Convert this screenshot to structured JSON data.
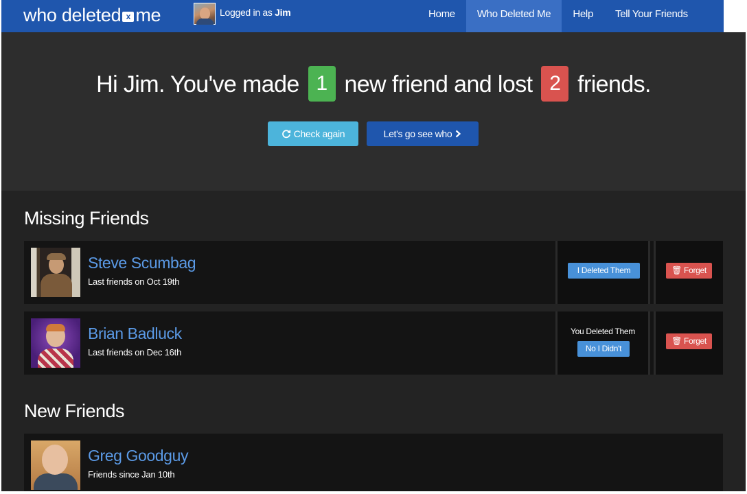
{
  "brand": {
    "pre": "who deleted",
    "x_mark": "x",
    "post": "me"
  },
  "header": {
    "logged_prefix": "Logged in as ",
    "user": "Jim"
  },
  "nav": [
    {
      "label": "Home",
      "active": false
    },
    {
      "label": "Who Deleted Me",
      "active": true
    },
    {
      "label": "Help",
      "active": false
    },
    {
      "label": "Tell Your Friends",
      "active": false
    }
  ],
  "hero": {
    "greeting": "Hi Jim. You've made",
    "new_count": "1",
    "middle": "new friend and lost",
    "lost_count": "2",
    "suffix": "friends.",
    "check_again_label": "Check again",
    "go_see_label": "Let's go see who"
  },
  "missing_friends": {
    "title": "Missing Friends",
    "items": [
      {
        "name": "Steve Scumbag",
        "meta": "Last friends on Oct 19th",
        "status_button": "I Deleted Them",
        "forget_label": "Forget"
      },
      {
        "name": "Brian Badluck",
        "meta": "Last friends on Dec 16th",
        "status_text": "You Deleted Them",
        "status_button": "No I Didn't",
        "forget_label": "Forget"
      }
    ]
  },
  "new_friends": {
    "title": "New Friends",
    "items": [
      {
        "name": "Greg Goodguy",
        "meta": "Friends since Jan 10th"
      }
    ]
  },
  "colors": {
    "navbar": "#1f56ad",
    "nav_active": "#3a6fc4",
    "new_badge": "#4cb352",
    "lost_badge": "#d9534f",
    "link": "#5b9ae6",
    "info_button": "#4cb4db"
  },
  "icons": {
    "check_again": "refresh-icon",
    "go_see": "chevron-right-icon",
    "forget": "trash-icon"
  }
}
